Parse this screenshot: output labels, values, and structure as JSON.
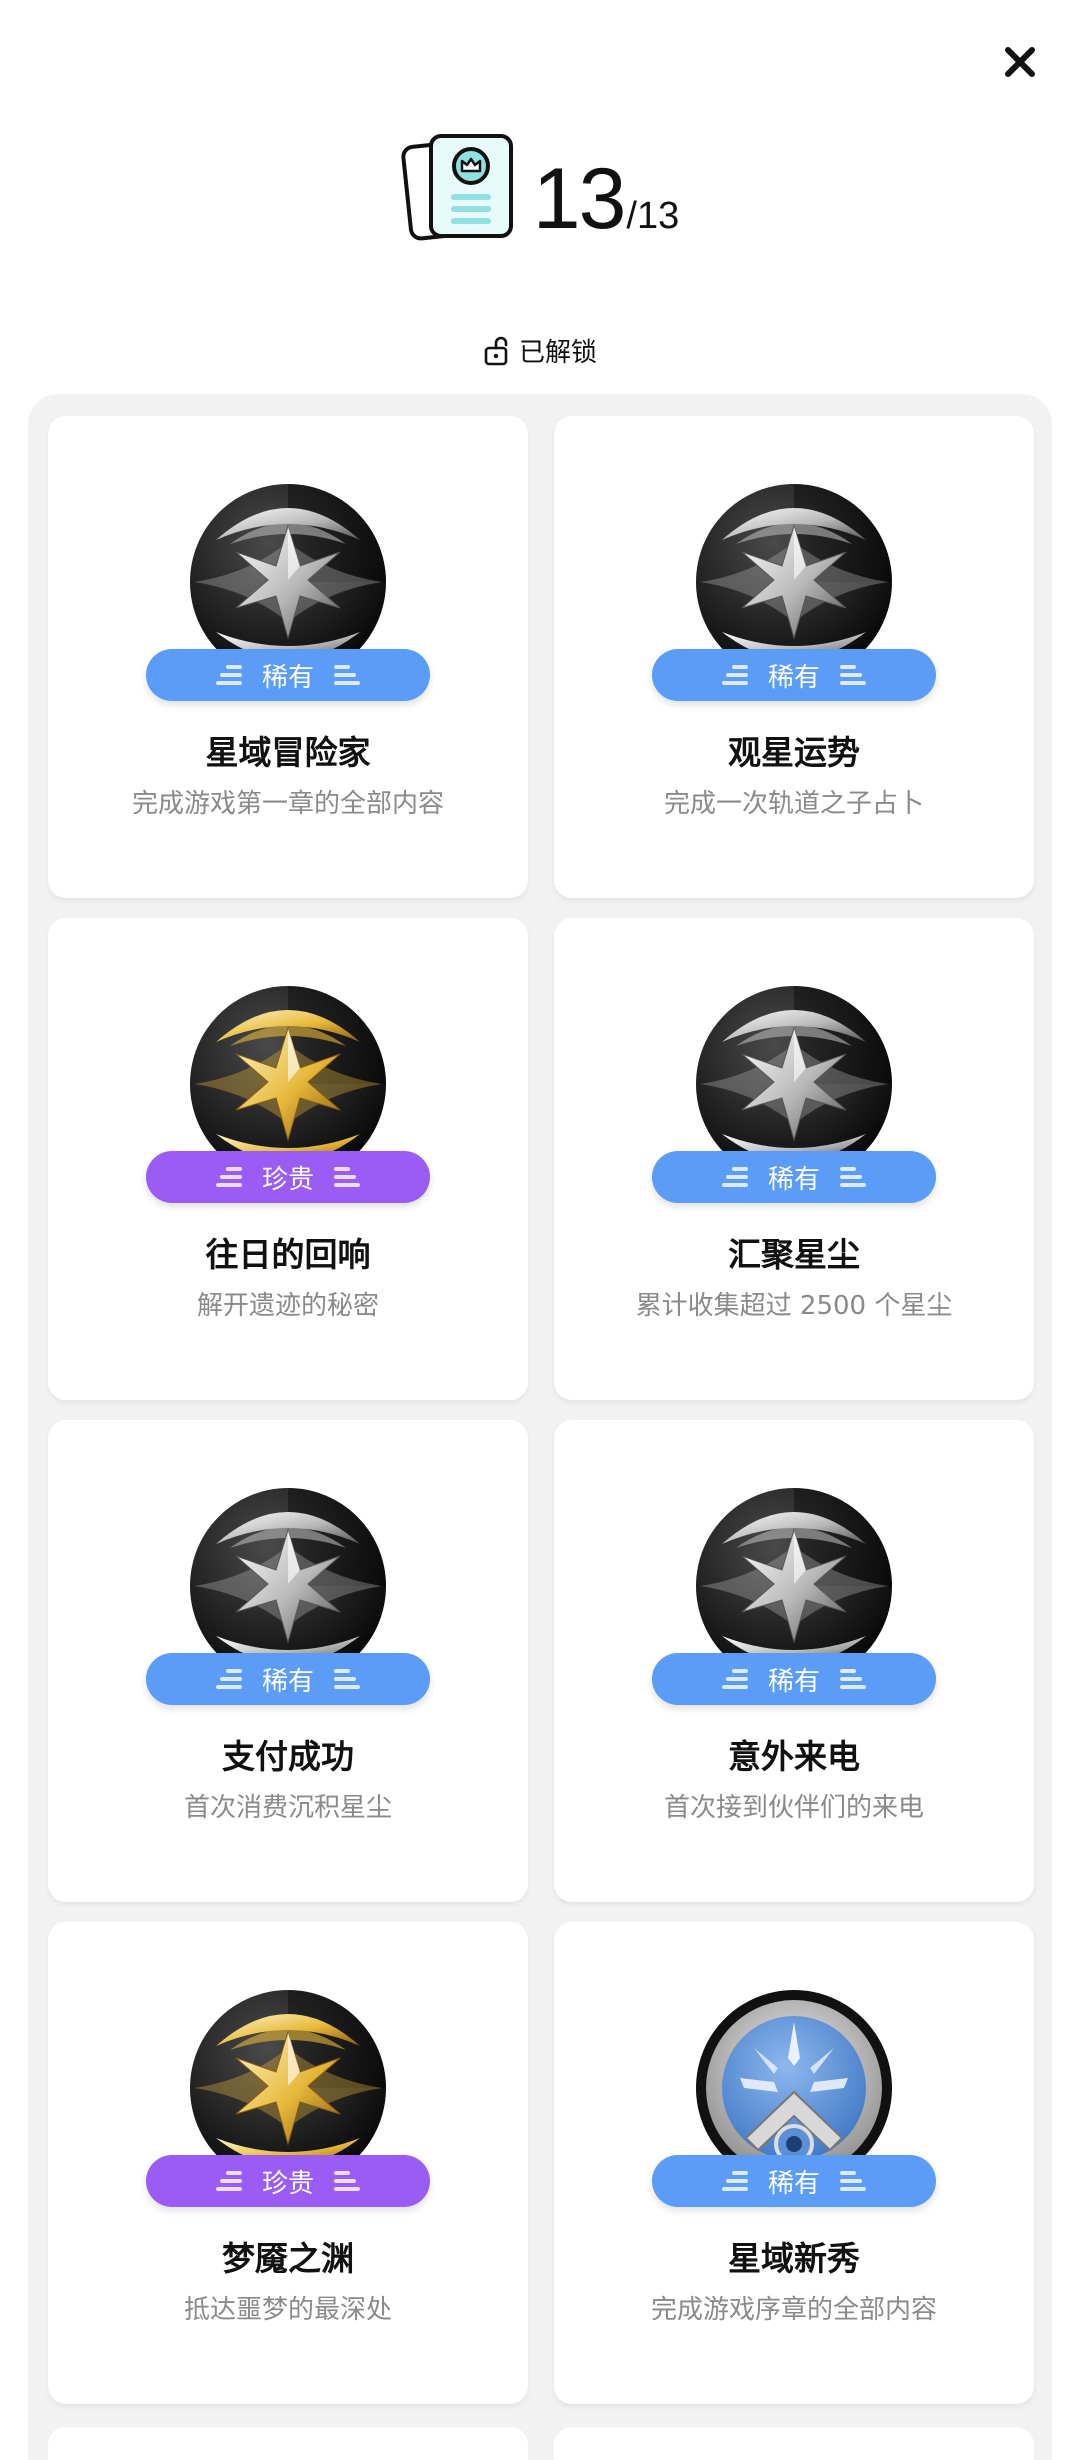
{
  "header": {
    "count": "13",
    "total": "/13",
    "unlocked_label": "已解锁"
  },
  "achievements": [
    {
      "title": "星域冒险家",
      "description": "完成游戏第一章的全部内容",
      "rarity": "稀有",
      "rarity_type": "rare",
      "badge": "silver-star-badge"
    },
    {
      "title": "观星运势",
      "description": "完成一次轨道之子占卜",
      "rarity": "稀有",
      "rarity_type": "rare",
      "badge": "silver-star-badge"
    },
    {
      "title": "往日的回响",
      "description": "解开遗迹的秘密",
      "rarity": "珍贵",
      "rarity_type": "epic",
      "badge": "gold-star-badge"
    },
    {
      "title": "汇聚星尘",
      "description": "累计收集超过 2500 个星尘",
      "rarity": "稀有",
      "rarity_type": "rare",
      "badge": "silver-star-badge"
    },
    {
      "title": "支付成功",
      "description": "首次消费沉积星尘",
      "rarity": "稀有",
      "rarity_type": "rare",
      "badge": "silver-star-badge"
    },
    {
      "title": "意外来电",
      "description": "首次接到伙伴们的来电",
      "rarity": "稀有",
      "rarity_type": "rare",
      "badge": "silver-star-badge"
    },
    {
      "title": "梦魇之渊",
      "description": "抵达噩梦的最深处",
      "rarity": "珍贵",
      "rarity_type": "epic",
      "badge": "gold-star-badge"
    },
    {
      "title": "星域新秀",
      "description": "完成游戏序章的全部内容",
      "rarity": "稀有",
      "rarity_type": "rare",
      "badge": "blue-compass-badge"
    }
  ],
  "colors": {
    "rare": "#5b9cf6",
    "epic": "#9a5cf3",
    "panel": "#f2f2f2",
    "description_text": "#8a8a8a"
  }
}
